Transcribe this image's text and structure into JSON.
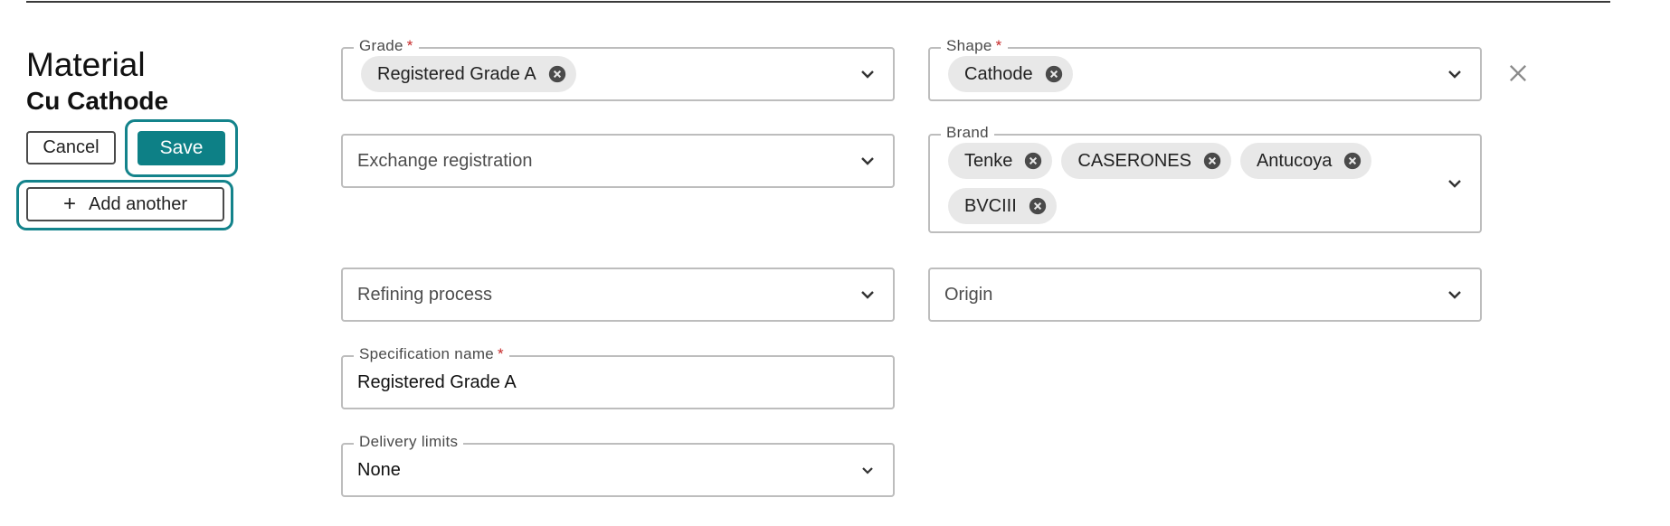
{
  "material": {
    "title": "Material",
    "subtitle": "Cu Cathode"
  },
  "actions": {
    "cancel_label": "Cancel",
    "save_label": "Save",
    "add_another_label": "Add another"
  },
  "form": {
    "grade": {
      "label": "Grade",
      "required_mark": "*",
      "chips": [
        "Registered Grade A"
      ]
    },
    "shape": {
      "label": "Shape",
      "required_mark": "*",
      "chips": [
        "Cathode"
      ]
    },
    "exchange_registration": {
      "placeholder": "Exchange registration"
    },
    "brand": {
      "label": "Brand",
      "chips": [
        "Tenke",
        "CASERONES",
        "Antucoya",
        "BVCIII"
      ]
    },
    "refining_process": {
      "placeholder": "Refining process"
    },
    "origin": {
      "placeholder": "Origin"
    },
    "specification_name": {
      "label": "Specification name",
      "required_mark": "*",
      "value": "Registered Grade A"
    },
    "delivery_limits": {
      "label": "Delivery limits",
      "value": "None"
    }
  },
  "icons": {
    "dropdown": "chevron-down-icon",
    "chip_remove": "cancel-circle-icon",
    "add": "plus-icon",
    "close": "close-icon"
  },
  "colors": {
    "accent": "#0d8086",
    "focus_ring": "#13838b",
    "required": "#c62828",
    "chip_bg": "#e8e8e8",
    "field_border": "#bdbdbd"
  }
}
